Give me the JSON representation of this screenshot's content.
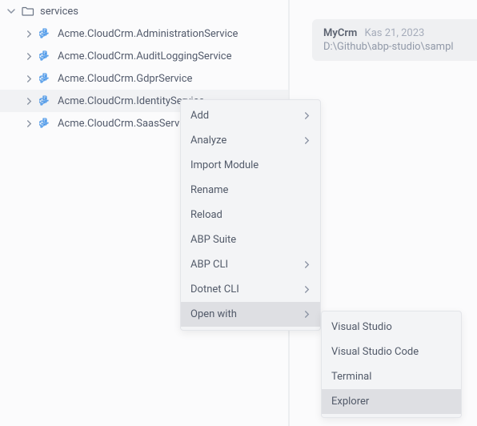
{
  "tree": {
    "folder_label": "services",
    "items": [
      {
        "label": "Acme.CloudCrm.AdministrationService",
        "selected": false
      },
      {
        "label": "Acme.CloudCrm.AuditLoggingService",
        "selected": false
      },
      {
        "label": "Acme.CloudCrm.GdprService",
        "selected": false
      },
      {
        "label": "Acme.CloudCrm.IdentityService",
        "selected": true
      },
      {
        "label": "Acme.CloudCrm.SaasService",
        "selected": false
      }
    ]
  },
  "project": {
    "title": "MyCrm",
    "date": "Kas 21, 2023",
    "path": "D:\\Github\\abp-studio\\sampl"
  },
  "context_menu": {
    "items": [
      {
        "label": "Add",
        "has_submenu": true,
        "highlighted": false
      },
      {
        "label": "Analyze",
        "has_submenu": true,
        "highlighted": false
      },
      {
        "label": "Import Module",
        "has_submenu": false,
        "highlighted": false
      },
      {
        "label": "Rename",
        "has_submenu": false,
        "highlighted": false
      },
      {
        "label": "Reload",
        "has_submenu": false,
        "highlighted": false
      },
      {
        "label": "ABP Suite",
        "has_submenu": false,
        "highlighted": false
      },
      {
        "label": "ABP CLI",
        "has_submenu": true,
        "highlighted": false
      },
      {
        "label": "Dotnet CLI",
        "has_submenu": true,
        "highlighted": false
      },
      {
        "label": "Open with",
        "has_submenu": true,
        "highlighted": true
      }
    ]
  },
  "submenu": {
    "items": [
      {
        "label": "Visual Studio",
        "highlighted": false
      },
      {
        "label": "Visual Studio Code",
        "highlighted": false
      },
      {
        "label": "Terminal",
        "highlighted": false
      },
      {
        "label": "Explorer",
        "highlighted": true
      }
    ]
  }
}
